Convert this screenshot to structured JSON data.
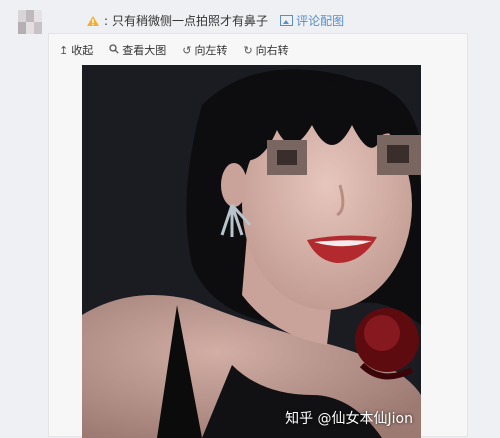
{
  "post": {
    "comment_text": "只有稍微侧一点拍照才有鼻子",
    "comment_image_link": "评论配图"
  },
  "toolbar": {
    "collapse": "收起",
    "view_large": "查看大图",
    "rotate_left": "向左转",
    "rotate_right": "向右转"
  },
  "photo": {
    "watermark": "知乎 @仙女本仙Jion"
  },
  "colors": {
    "link": "#5a8ec7",
    "page_bg": "#eef0f3"
  }
}
